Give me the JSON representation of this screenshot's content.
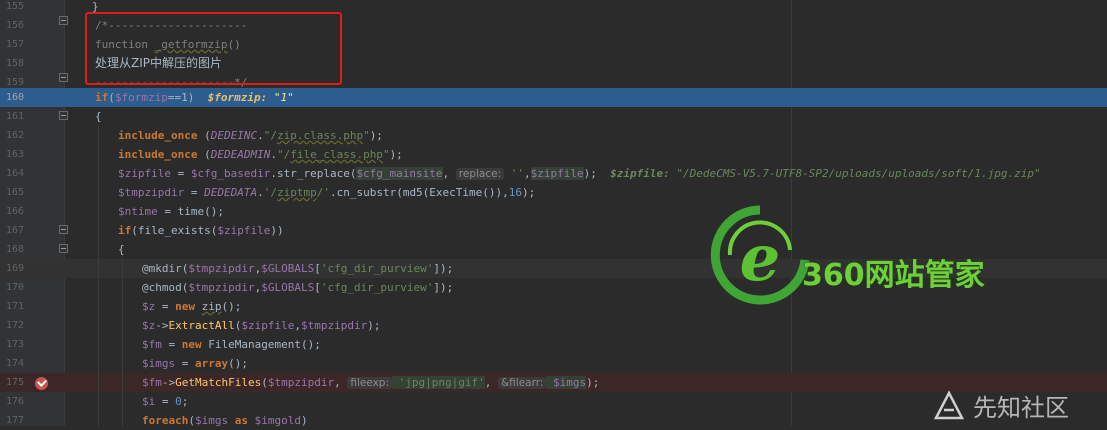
{
  "gutter": {
    "line_numbers": [
      "155",
      "156",
      "157",
      "158",
      "159",
      "160",
      "161",
      "162",
      "163",
      "164",
      "165",
      "166",
      "167",
      "168",
      "169",
      "170",
      "171",
      "172",
      "173",
      "174",
      "175",
      "176",
      "177"
    ]
  },
  "code": {
    "l155": "}",
    "l156": "/*---------------------",
    "l157_a": "function ",
    "l157_b": "_getformzip",
    "l157_c": "()",
    "l158": "处理从ZIP中解压的图片",
    "l159": "---------------------*/",
    "l160_kw": "if",
    "l160_a": "(",
    "l160_var": "$formzip",
    "l160_b": "==1)",
    "l160_dbg_name": "$formzip:",
    "l160_dbg_val": "\"1\"",
    "l161": "{",
    "l162_kw": "include_once",
    "l162_a": " (",
    "l162_cst": "DEDEINC",
    "l162_b": ".",
    "l162_str1": "\"/",
    "l162_str2": "zip.class.php",
    "l162_str3": "\"",
    "l162_c": ");",
    "l163_kw": "include_once",
    "l163_a": " (",
    "l163_cst": "DEDEADMIN",
    "l163_b": ".",
    "l163_str1": "\"/",
    "l163_str2": "file_class.php",
    "l163_str3": "\"",
    "l163_c": ");",
    "l164_var": "$zipfile",
    "l164_a": " = ",
    "l164_var2": "$cfg_basedir",
    "l164_b": ".str_replace(",
    "l164_var3": "$cfg_mainsite",
    "l164_c": ", ",
    "l164_hint": "replace:",
    "l164_str": " ''",
    "l164_d": ",",
    "l164_var4": "$zipfile",
    "l164_e": ");",
    "l164_dbg_name": "$zipfile:",
    "l164_dbg_val": "\"/DedeCMS-V5.7-UTF8-SP2/uploads/uploads/soft/1.jpg.zip\"",
    "l165_var": "$tmpzipdir",
    "l165_a": " = ",
    "l165_cst": "DEDEDATA",
    "l165_b": ".",
    "l165_str1": "'/",
    "l165_str2": "ziptmp",
    "l165_str3": "/'",
    "l165_c": ".cn_substr(md5(ExecTime()),",
    "l165_num": "16",
    "l165_d": ");",
    "l166_var": "$ntime",
    "l166_a": " = time();",
    "l167_kw": "if",
    "l167_a": "(file_exists(",
    "l167_var": "$zipfile",
    "l167_b": "))",
    "l168": "{",
    "l169_a": "@mkdir(",
    "l169_var": "$tmpzipdir",
    "l169_b": ",",
    "l169_var2": "$GLOBALS",
    "l169_c": "[",
    "l169_str": "'cfg_dir_purview'",
    "l169_d": "]);",
    "l170_a": "@chmod(",
    "l170_var": "$tmpzipdir",
    "l170_b": ",",
    "l170_var2": "$GLOBALS",
    "l170_c": "[",
    "l170_str": "'cfg_dir_purview'",
    "l170_d": "]);",
    "l171_var": "$z",
    "l171_a": " = ",
    "l171_kw": "new",
    "l171_b": " ",
    "l171_cls": "zip",
    "l171_c": "();",
    "l172_var": "$z",
    "l172_a": "->",
    "l172_fn": "ExtractAll",
    "l172_b": "(",
    "l172_var2": "$zipfile",
    "l172_c": ",",
    "l172_var3": "$tmpzipdir",
    "l172_d": ");",
    "l173_var": "$fm",
    "l173_a": " = ",
    "l173_kw": "new",
    "l173_b": " FileManagement();",
    "l174_var": "$imgs",
    "l174_a": " = ",
    "l174_kw": "array",
    "l174_b": "();",
    "l175_var": "$fm",
    "l175_a": "->",
    "l175_fn": "GetMatchFiles",
    "l175_b": "(",
    "l175_var2": "$tmpzipdir",
    "l175_c": ", ",
    "l175_hint1": "fileexp:",
    "l175_str": " 'jpg|png|gif'",
    "l175_d": ", ",
    "l175_hint2": "&filearr:",
    "l175_var3": " $imgs",
    "l175_e": ");",
    "l176_var": "$i",
    "l176_a": " = ",
    "l176_num": "0",
    "l176_b": ";",
    "l177_kw": "foreach",
    "l177_a": "(",
    "l177_var": "$imgs",
    "l177_b": " ",
    "l177_kw2": "as",
    "l177_c": " ",
    "l177_var2": "$imgold",
    "l177_d": ")"
  },
  "watermarks": {
    "logo_letter": "e",
    "brand": "360网站管家",
    "corner": "先知社区"
  },
  "colors": {
    "background": "#2b2b2b",
    "highlight_line": "#2d5c8e",
    "annotation_box": "#e11b1b",
    "breakpoint": "#c75450"
  }
}
